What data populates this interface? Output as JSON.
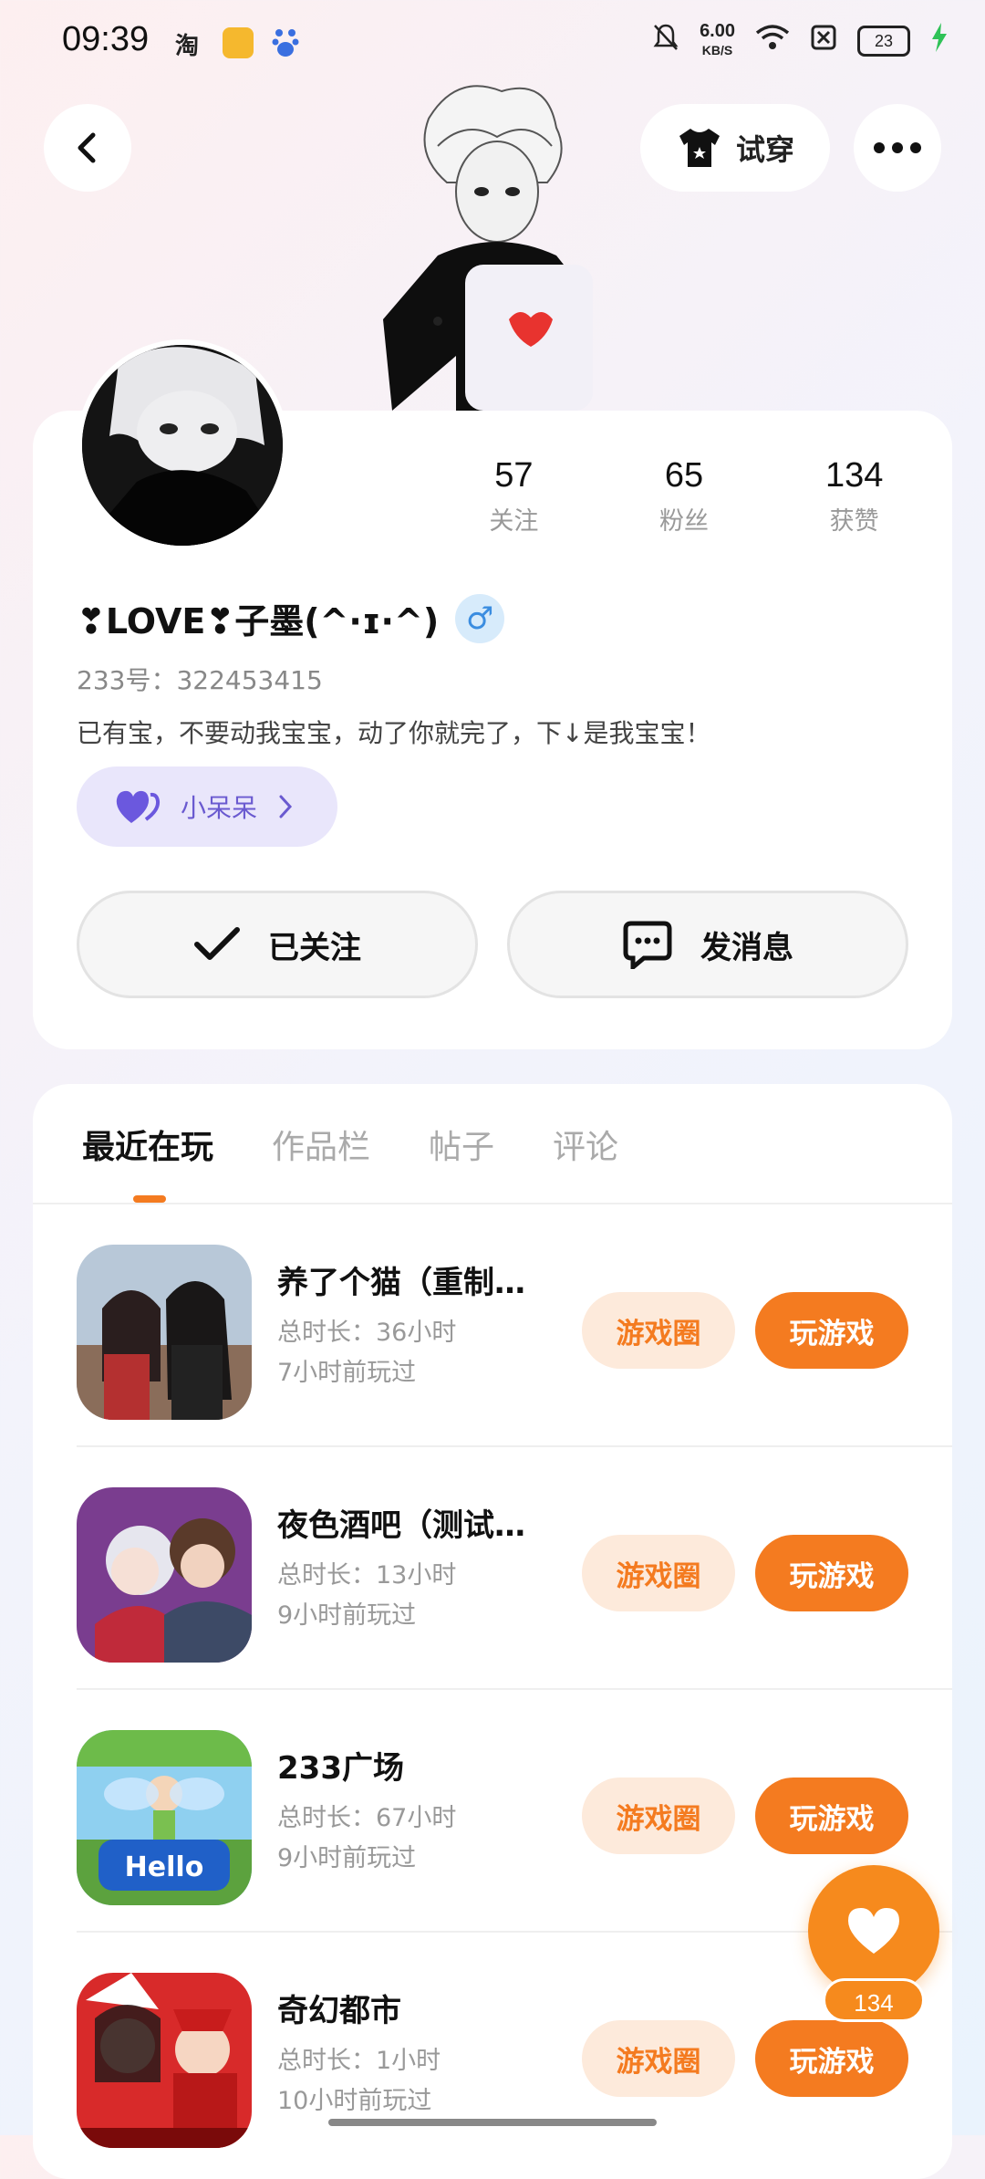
{
  "status_bar": {
    "time": "09:39",
    "app_icon_1": "淘",
    "net_speed_value": "6.00",
    "net_speed_unit": "KB/S",
    "battery": "23",
    "icons": [
      "taobao-icon",
      "reader-icon",
      "baidu-icon",
      "mute-bell-icon",
      "wifi-icon",
      "sim-off-icon",
      "battery-icon",
      "charging-icon"
    ]
  },
  "header": {
    "try_on_label": "试穿"
  },
  "profile": {
    "stats": [
      {
        "value": "57",
        "label": "关注"
      },
      {
        "value": "65",
        "label": "粉丝"
      },
      {
        "value": "134",
        "label": "获赞"
      }
    ],
    "name": "❣LOVE❣子墨(^·ɪ·^)",
    "gender": "♂",
    "uid": "233号：322453415",
    "bio": "已有宝，不要动我宝宝，动了你就完了，下↓是我宝宝！",
    "couple_tag": "小呆呆",
    "follow_label": "已关注",
    "message_label": "发消息"
  },
  "tabs": [
    "最近在玩",
    "作品栏",
    "帖子",
    "评论"
  ],
  "games": [
    {
      "title": "养了个猫（重制…",
      "duration": "总时长：36小时",
      "last_played": "7小时前玩过"
    },
    {
      "title": "夜色酒吧（测试…",
      "duration": "总时长：13小时",
      "last_played": "9小时前玩过"
    },
    {
      "title": "233广场",
      "duration": "总时长：67小时",
      "last_played": "9小时前玩过"
    },
    {
      "title": "奇幻都市",
      "duration": "总时长：1小时",
      "last_played": "10小时前玩过"
    }
  ],
  "game_buttons": {
    "circle": "游戏圈",
    "play": "玩游戏"
  },
  "like_fab": {
    "count": "134"
  },
  "colors": {
    "accent": "#f47b20",
    "accent_light": "#fdeadb",
    "tag_bg": "#e9e6fb",
    "tag_text": "#6a5ad0"
  }
}
